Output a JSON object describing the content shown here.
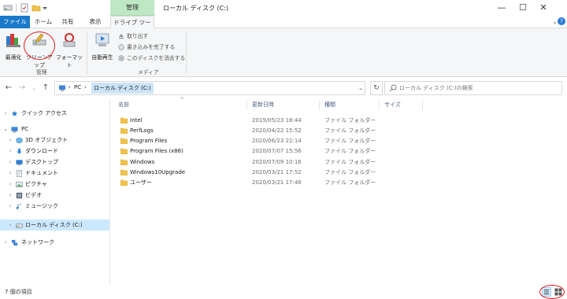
{
  "window": {
    "title": "ローカル ディスク (C:)",
    "context_group": "管理",
    "min_symbol": "—",
    "max_symbol": "☐",
    "close_symbol": "✕"
  },
  "tabs": [
    {
      "label": "ファイル"
    },
    {
      "label": "ホーム"
    },
    {
      "label": "共有"
    },
    {
      "label": "表示"
    },
    {
      "label": "ドライブ ツール"
    }
  ],
  "ribbon": {
    "optimize_label": "最適化",
    "cleanup_label": "クリーンアップ",
    "format_label": "フォーマット",
    "group_manage_label": "管理",
    "autoplay_label": "自動再生",
    "eject_label": "取り出す",
    "finish_burn_label": "書き込みを完了する",
    "erase_disc_label": "このディスクを消去する",
    "group_media_label": "メディア"
  },
  "address": {
    "pc_label": "PC",
    "current_label": "ローカル ディスク (C:)",
    "sep": "›"
  },
  "search": {
    "placeholder": "ローカル ディスク (C:)の検索"
  },
  "nav": {
    "quick_access": "クイック アクセス",
    "pc": "PC",
    "items": [
      {
        "label": "3D オブジェクト"
      },
      {
        "label": "ダウンロード"
      },
      {
        "label": "デスクトップ"
      },
      {
        "label": "ドキュメント"
      },
      {
        "label": "ピクチャ"
      },
      {
        "label": "ビデオ"
      },
      {
        "label": "ミュージック"
      },
      {
        "label": "ローカル ディスク (C:)"
      }
    ],
    "network": "ネットワーク"
  },
  "columns": {
    "name": "名前",
    "date": "更新日時",
    "type": "種類",
    "size": "サイズ"
  },
  "files": [
    {
      "name": "Intel",
      "date": "2019/05/23 18:44",
      "type": "ファイル フォルダー"
    },
    {
      "name": "PerfLogs",
      "date": "2020/04/22 15:52",
      "type": "ファイル フォルダー"
    },
    {
      "name": "Program Files",
      "date": "2020/06/23 22:14",
      "type": "ファイル フォルダー"
    },
    {
      "name": "Program Files (x86)",
      "date": "2020/07/07 15:56",
      "type": "ファイル フォルダー"
    },
    {
      "name": "Windows",
      "date": "2020/07/09 10:16",
      "type": "ファイル フォルダー"
    },
    {
      "name": "Windows10Upgrade",
      "date": "2020/03/21 17:52",
      "type": "ファイル フォルダー"
    },
    {
      "name": "ユーザー",
      "date": "2020/03/21 17:46",
      "type": "ファイル フォルダー"
    }
  ],
  "status": {
    "item_count": "7 個の項目"
  },
  "colors": {
    "accent": "#1979ca",
    "context_tab": "#bde8c3",
    "selection": "#cce8ff",
    "folder": "#f0c24b",
    "annotation": "#e0201e"
  }
}
